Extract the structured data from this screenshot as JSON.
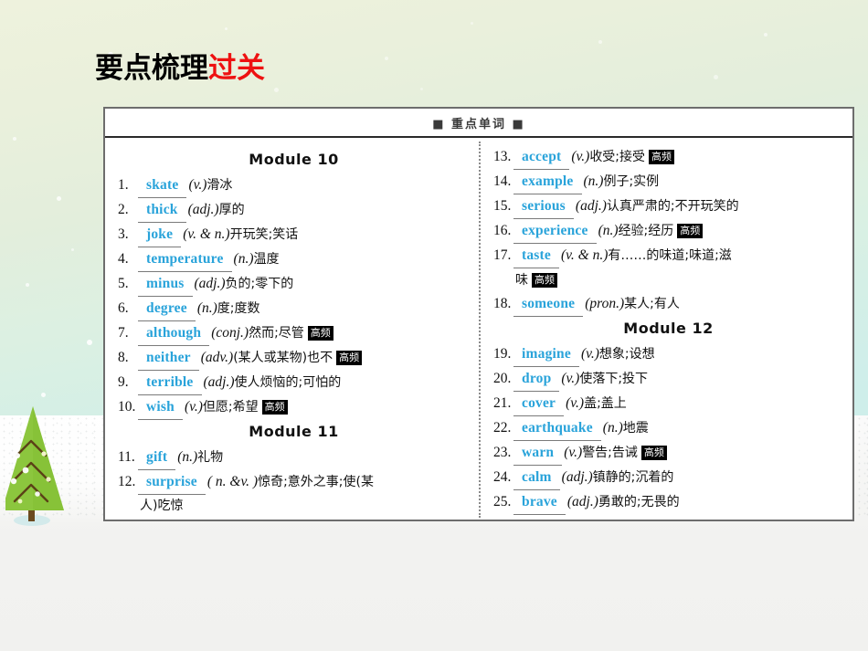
{
  "heading": {
    "black_part": "要点梳理",
    "red_part": "过关",
    "black_color": "#000000",
    "red_color": "#ee1111"
  },
  "word_box": {
    "header": "■ 重点单词 ■",
    "accent_blue": "#29a3da",
    "badge_label": "高频",
    "left_column": {
      "module_titles": {
        "first": "Module 10",
        "second": "Module 11"
      },
      "entries_module10": [
        {
          "num": "1.",
          "word": "skate",
          "pos": "(v.)",
          "cn": "滑冰",
          "badge": false
        },
        {
          "num": "2.",
          "word": "thick",
          "pos": "(adj.)",
          "cn": "厚的",
          "badge": false
        },
        {
          "num": "3.",
          "word": "joke",
          "pos": "(v. & n.)",
          "cn": "开玩笑;笑话",
          "badge": false
        },
        {
          "num": "4.",
          "word": "temperature",
          "pos": "(n.)",
          "cn": "温度",
          "badge": false
        },
        {
          "num": "5.",
          "word": "minus",
          "pos": "(adj.)",
          "cn": "负的;零下的",
          "badge": false
        },
        {
          "num": "6.",
          "word": "degree",
          "pos": "(n.)",
          "cn": "度;度数",
          "badge": false
        },
        {
          "num": "7.",
          "word": "although",
          "pos": "(conj.)",
          "cn": "然而;尽管",
          "badge": true
        },
        {
          "num": "8.",
          "word": "neither",
          "pos": "(adv.)",
          "cn": "(某人或某物)也不",
          "badge": true
        },
        {
          "num": "9.",
          "word": "terrible",
          "pos": "(adj.)",
          "cn": "使人烦恼的;可怕的",
          "badge": false
        },
        {
          "num": "10.",
          "word": "wish",
          "pos": "(v.)",
          "cn": "但愿;希望",
          "badge": true
        }
      ],
      "entries_module11": [
        {
          "num": "11.",
          "word": "gift",
          "pos": "(n.)",
          "cn": "礼物",
          "badge": false,
          "cont": ""
        },
        {
          "num": "12.",
          "word": "surprise",
          "pos": "( n. &v. )",
          "cn": "惊奇;意外之事;使(某",
          "badge": false,
          "cont": "人)吃惊"
        }
      ]
    },
    "right_column": {
      "module_titles": {
        "first": "Module 12"
      },
      "entries_module11_cont": [
        {
          "num": "13.",
          "word": "accept",
          "pos": "(v.)",
          "cn": "收受;接受",
          "badge": true,
          "cont": ""
        },
        {
          "num": "14.",
          "word": "example",
          "pos": "(n.)",
          "cn": "例子;实例",
          "badge": false,
          "cont": ""
        },
        {
          "num": "15.",
          "word": "serious",
          "pos": "(adj.)",
          "cn": "认真严肃的;不开玩笑的",
          "badge": false,
          "cont": ""
        },
        {
          "num": "16.",
          "word": "experience",
          "pos": "(n.)",
          "cn": "经验;经历",
          "badge": true,
          "cont": ""
        },
        {
          "num": "17.",
          "word": "taste",
          "pos": "(v. & n.)",
          "cn": "有……的味道;味道;滋",
          "badge": false,
          "cont": "味",
          "cont_badge": true
        },
        {
          "num": "18.",
          "word": "someone",
          "pos": "(pron.)",
          "cn": "某人;有人",
          "badge": false,
          "cont": ""
        }
      ],
      "entries_module12": [
        {
          "num": "19.",
          "word": "imagine",
          "pos": "(v.)",
          "cn": "想象;设想",
          "badge": false
        },
        {
          "num": "20.",
          "word": "drop",
          "pos": "(v.)",
          "cn": "使落下;投下",
          "badge": false
        },
        {
          "num": "21.",
          "word": "cover",
          "pos": "(v.)",
          "cn": "盖;盖上",
          "badge": false
        },
        {
          "num": "22.",
          "word": "earthquake",
          "pos": "(n.)",
          "cn": "地震",
          "badge": false
        },
        {
          "num": "23.",
          "word": "warn",
          "pos": "(v.)",
          "cn": "警告;告诫",
          "badge": true
        },
        {
          "num": "24.",
          "word": "calm",
          "pos": "(adj.)",
          "cn": "镇静的;沉着的",
          "badge": false
        },
        {
          "num": "25.",
          "word": "brave",
          "pos": "(adj.)",
          "cn": "勇敢的;无畏的",
          "badge": false
        }
      ]
    }
  },
  "decor": {
    "tree_foliage_color": "#8cc63e",
    "tree_trunk_color": "#6b4a1f",
    "sky_top_color": "#eef2dd",
    "sky_bottom_color": "#cceeeb",
    "snow_color": "#fcfcfc"
  }
}
